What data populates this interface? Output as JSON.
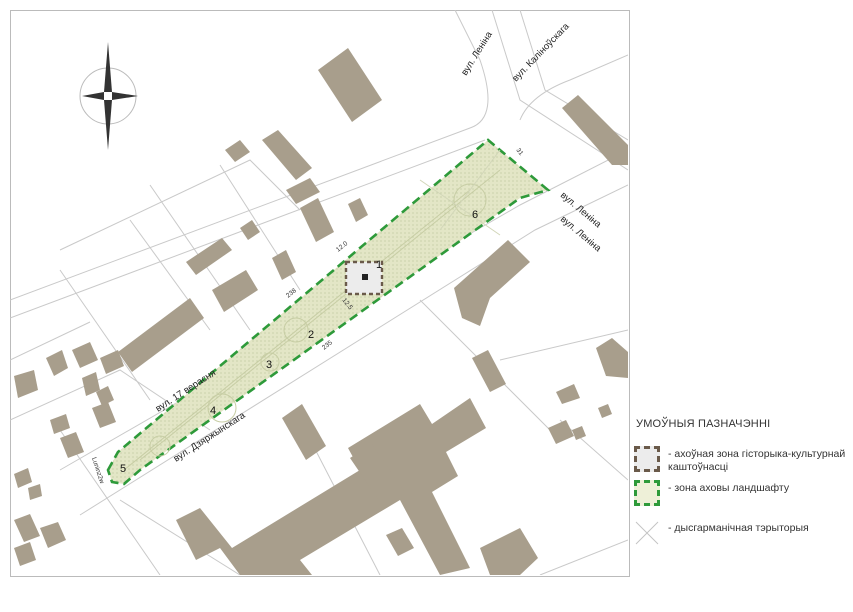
{
  "streets": {
    "lenina_a": "вул. Леніна",
    "kalinouskaga": "вул. Каліноўскага",
    "lenina_b": "вул. Леніна",
    "lenina_c": "вул. Леніна",
    "dzyarzhynskaga": "вул. Дзяржынскага",
    "verasnya": "вул. 17 верасня",
    "lunin": "Luninz2w"
  },
  "zone_numbers": [
    "1",
    "2",
    "3",
    "4",
    "5",
    "6"
  ],
  "dimensions": {
    "d31": "31",
    "d12": "12.0",
    "d238": "238",
    "d125": "12.5",
    "d235": "235"
  },
  "legend": {
    "title": "УМОЎНЫЯ ПАЗНАЧЭННІ",
    "items": [
      {
        "text": "- ахоўная зона гісторыка-культурнай каштоўнасці"
      },
      {
        "text": "- зона аховы ландшафту"
      },
      {
        "text": "- дысгарманічная тэрыторыя"
      }
    ]
  },
  "colors": {
    "building": "#a89e8c",
    "landscape_fill": "#dfe3c2",
    "landscape_border": "#2e9a3a",
    "heritage_border": "#6a5a4a",
    "street_line": "#c9c9c9"
  }
}
